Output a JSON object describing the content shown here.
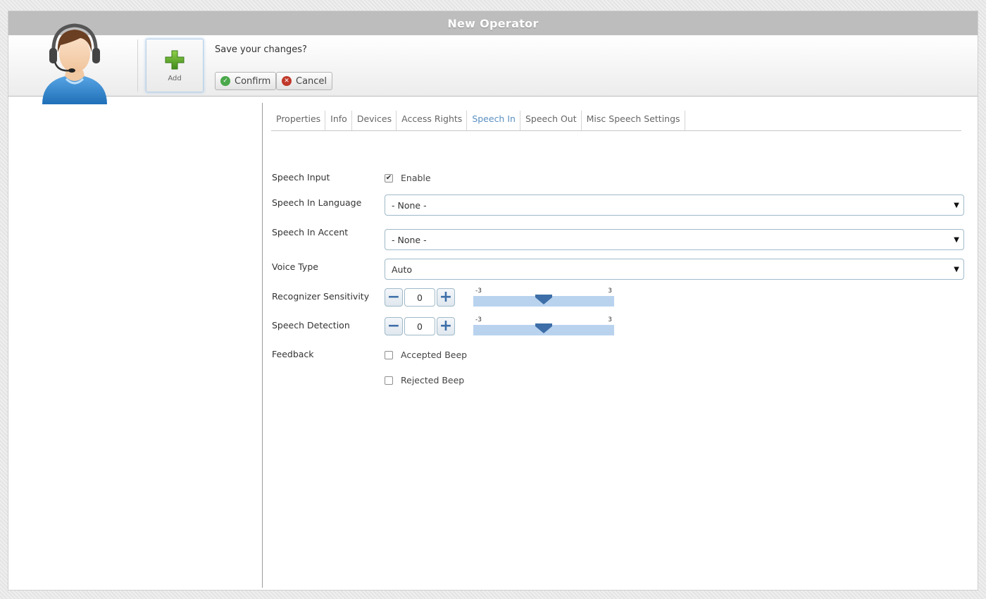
{
  "window": {
    "title": "New Operator"
  },
  "header": {
    "add_label": "Add",
    "save_prompt": "Save your changes?",
    "confirm_label": "Confirm",
    "cancel_label": "Cancel"
  },
  "tabs": [
    {
      "label": "Properties",
      "active": false
    },
    {
      "label": "Info",
      "active": false
    },
    {
      "label": "Devices",
      "active": false
    },
    {
      "label": "Access Rights",
      "active": false
    },
    {
      "label": "Speech In",
      "active": true
    },
    {
      "label": "Speech Out",
      "active": false
    },
    {
      "label": "Misc Speech Settings",
      "active": false
    }
  ],
  "form": {
    "speech_input": {
      "label": "Speech Input",
      "checkbox_label": "Enable",
      "checked": true
    },
    "speech_in_language": {
      "label": "Speech In Language",
      "value": "- None -"
    },
    "speech_in_accent": {
      "label": "Speech In Accent",
      "value": "- None -"
    },
    "voice_type": {
      "label": "Voice Type",
      "value": "Auto"
    },
    "recognizer_sensitivity": {
      "label": "Recognizer Sensitivity",
      "value": "0",
      "min": "-3",
      "max": "3"
    },
    "speech_detection": {
      "label": "Speech Detection",
      "value": "0",
      "min": "-3",
      "max": "3"
    },
    "feedback": {
      "label": "Feedback",
      "accepted_beep": {
        "label": "Accepted Beep",
        "checked": false
      },
      "rejected_beep": {
        "label": "Rejected Beep",
        "checked": false
      }
    }
  },
  "colors": {
    "accent": "#5a8fc0",
    "title_bar": "#bdbdbd",
    "slider_track": "#b9d3ef",
    "slider_thumb": "#3d6ea8"
  }
}
